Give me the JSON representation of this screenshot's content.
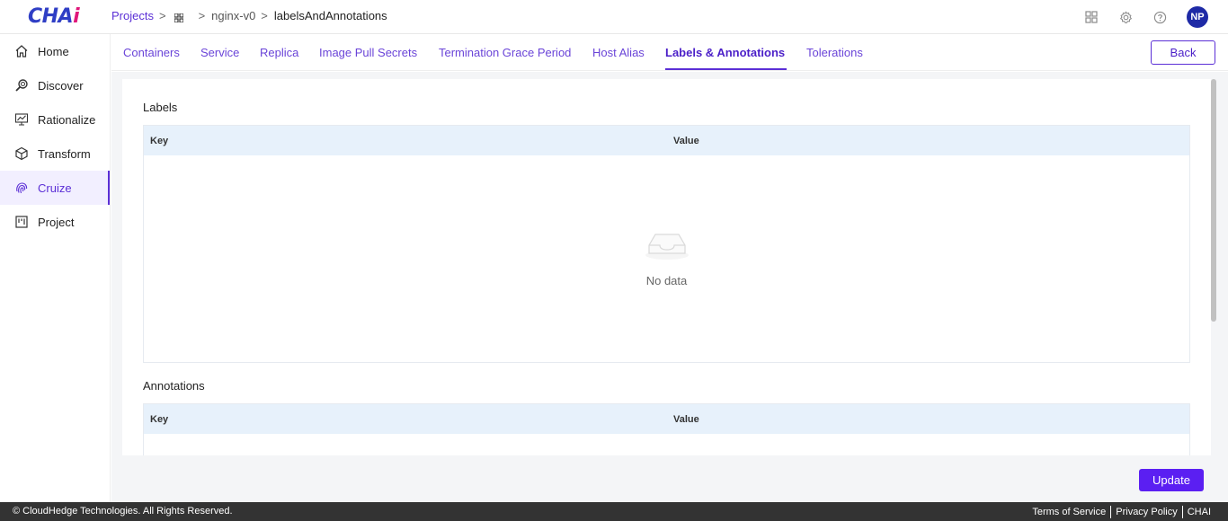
{
  "app": {
    "logo_part1": "CHA",
    "logo_part2": "i",
    "user_initials": "NP"
  },
  "breadcrumb": {
    "projects": "Projects",
    "sep": ">",
    "project": "nginx-v0",
    "current": "labelsAndAnnotations"
  },
  "top_icons": [
    "apps-grid-icon",
    "settings-gear-icon",
    "help-icon"
  ],
  "sidebar": {
    "items": [
      {
        "label": "Home",
        "icon": "home-icon"
      },
      {
        "label": "Discover",
        "icon": "discover-search-icon"
      },
      {
        "label": "Rationalize",
        "icon": "rationalize-chart-icon"
      },
      {
        "label": "Transform",
        "icon": "transform-cube-icon"
      },
      {
        "label": "Cruize",
        "icon": "cruize-fingerprint-icon",
        "active": true
      },
      {
        "label": "Project",
        "icon": "project-board-icon"
      }
    ]
  },
  "tabs": {
    "items": [
      "Containers",
      "Service",
      "Replica",
      "Image Pull Secrets",
      "Termination Grace Period",
      "Host Alias",
      "Labels & Annotations",
      "Tolerations"
    ],
    "active": "Labels & Annotations",
    "back_label": "Back"
  },
  "labels_section": {
    "title": "Labels",
    "columns": [
      "Key",
      "Value"
    ],
    "empty_text": "No data"
  },
  "annotations_section": {
    "title": "Annotations",
    "columns": [
      "Key",
      "Value"
    ]
  },
  "update_label": "Update",
  "footer": {
    "copyright": "© CloudHedge Technologies. All Rights Reserved.",
    "links": [
      "Terms of Service",
      "Privacy Policy",
      "CHAI"
    ]
  },
  "colors": {
    "accent": "#5b2fd6",
    "update_button": "#5b1ff2",
    "table_header": "#e7f1fb",
    "footer_bg": "#333333",
    "avatar_bg": "#1e2aa6"
  }
}
